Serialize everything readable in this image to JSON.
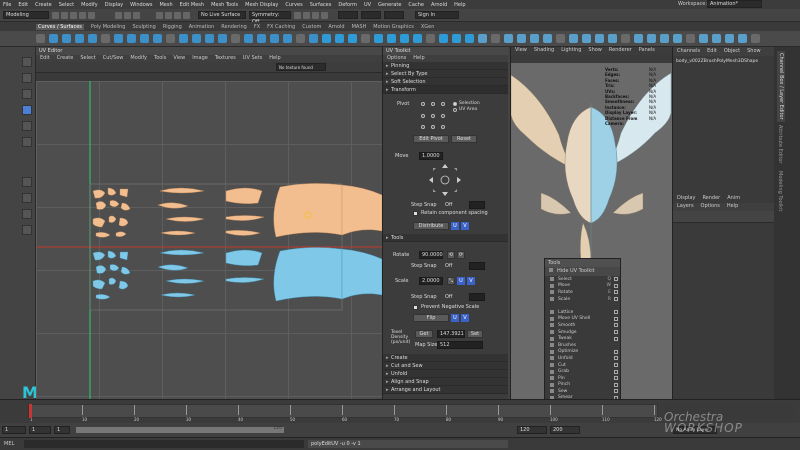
{
  "menubar": {
    "items": [
      "File",
      "Edit",
      "Create",
      "Select",
      "Modify",
      "Display",
      "Windows",
      "Mesh",
      "Edit Mesh",
      "Mesh Tools",
      "Mesh Display",
      "Curves",
      "Surfaces",
      "Deform",
      "UV",
      "Generate",
      "Cache",
      "Arnold",
      "Help"
    ],
    "workspace_label": "Workspace:",
    "workspace_value": "Animation*"
  },
  "statusline": {
    "mode": "Modeling",
    "live_surface": "No Live Surface",
    "symmetry": "Symmetry: Off",
    "sign_in": "Sign In"
  },
  "shelf": {
    "tabs": [
      "Curves / Surfaces",
      "Poly Modeling",
      "Sculpting",
      "Rigging",
      "Animation",
      "Rendering",
      "FX",
      "FX Caching",
      "Custom",
      "Arnold",
      "MASH",
      "Motion Graphics",
      "XGen"
    ],
    "active": "Curves / Surfaces"
  },
  "uv_editor": {
    "title": "UV Editor",
    "menu": [
      "Edit",
      "Create",
      "Select",
      "Cut/Sew",
      "Modify",
      "Tools",
      "View",
      "Image",
      "Textures",
      "UV Sets",
      "Help"
    ],
    "texture_field": "No texture found",
    "status": "(19/38) UV shells, (0/0) overlapping UVs, (0/0) reversed UVs"
  },
  "uv_toolkit": {
    "title": "UV Toolkit",
    "menu": [
      "Options",
      "Help"
    ],
    "sections_top": [
      "Pinning",
      "Select By Type",
      "Soft Selection"
    ],
    "transform": {
      "header": "Transform",
      "pivot_label": "Pivot",
      "pivot_opt1": "Selection",
      "pivot_opt2": "UV Area",
      "edit_pivot": "Edit Pivot",
      "reset": "Reset",
      "move_label": "Move",
      "move_value": "1.0000",
      "step_snap_label": "Step Snap",
      "step_snap_value": "Off",
      "retain_spacing": "Retain component spacing",
      "distribute": "Distribute",
      "u": "U",
      "v": "V"
    },
    "tools": {
      "header": "Tools",
      "rotate_label": "Rotate",
      "rotate_value": "90.0000",
      "scale_label": "Scale",
      "scale_value": "2.0000",
      "prevent_negative": "Prevent Negative Scale",
      "flip": "Flip",
      "texel_label": "Texel Density (px/unit)",
      "get": "Get",
      "density_value": "147.3921",
      "set": "Set",
      "map_size_label": "Map Size:",
      "map_size_value": "512"
    },
    "sections_bottom": [
      "Create",
      "Cut and Sew",
      "Unfold",
      "Align and Snap",
      "Arrange and Layout",
      "UV Sets"
    ]
  },
  "viewport": {
    "menu": [
      "View",
      "Shading",
      "Lighting",
      "Show",
      "Renderer",
      "Panels"
    ],
    "hud": [
      {
        "label": "Verts:",
        "value": "N/A"
      },
      {
        "label": "Edges:",
        "value": "N/A"
      },
      {
        "label": "Faces:",
        "value": "N/A"
      },
      {
        "label": "Tris:",
        "value": "N/A"
      },
      {
        "label": "UVs:",
        "value": "N/A"
      },
      {
        "label": "Backfaces:",
        "value": "N/A"
      },
      {
        "label": "Smoothness:",
        "value": "N/A"
      },
      {
        "label": "Instance:",
        "value": "N/A"
      },
      {
        "label": "Display Layer:",
        "value": "N/A"
      },
      {
        "label": "Distance From Camera:",
        "value": "N/A"
      }
    ]
  },
  "channel_box": {
    "menu": [
      "Channels",
      "Edit",
      "Object",
      "Show"
    ],
    "object_name": "body_v002ZBrushPolyMesh3DShape",
    "display_tabs": [
      "Display",
      "Render",
      "Anim"
    ],
    "display_menu": [
      "Layers",
      "Options",
      "Help"
    ],
    "side_tabs": [
      "Channel Box / Layer Editor",
      "Attribute Editor",
      "Modeling Toolkit"
    ]
  },
  "tools_panel": {
    "title": "Tools",
    "hide": "Hide UV Toolkit",
    "items": [
      {
        "label": "Select",
        "key": "Q"
      },
      {
        "label": "Move",
        "key": "W"
      },
      {
        "label": "Rotate",
        "key": "E"
      },
      {
        "label": "Scale",
        "key": "R"
      },
      {
        "label": "",
        "key": ""
      },
      {
        "label": "Lattice",
        "key": ""
      },
      {
        "label": "Move UV Shell",
        "key": ""
      },
      {
        "label": "Smooth",
        "key": ""
      },
      {
        "label": "Smudge",
        "key": ""
      },
      {
        "label": "Tweak",
        "key": ""
      },
      {
        "label": "Brushes",
        "key": ""
      },
      {
        "label": "Optimize",
        "key": ""
      },
      {
        "label": "Unfold",
        "key": ""
      },
      {
        "label": "Cut",
        "key": ""
      },
      {
        "label": "Grab",
        "key": ""
      },
      {
        "label": "Pin",
        "key": ""
      },
      {
        "label": "Pinch",
        "key": ""
      },
      {
        "label": "Sew",
        "key": ""
      },
      {
        "label": "Smear",
        "key": ""
      },
      {
        "label": "Symmetrize",
        "key": ""
      }
    ]
  },
  "timeline": {
    "ticks": [
      "1",
      "10",
      "20",
      "30",
      "40",
      "50",
      "60",
      "70",
      "80",
      "90",
      "100",
      "110",
      "120"
    ],
    "start": "1",
    "start2": "1",
    "current": "1",
    "end": "120",
    "end2": "120",
    "max": "200",
    "anim_layer": "No Anim Layer"
  },
  "command_line": {
    "lang": "MEL",
    "output": "polyEditUV -u 0 -v 1"
  },
  "watermark": {
    "line1": "Orchestra",
    "line2": "WORKSHOP"
  },
  "colors": {
    "orange_uv": "#f3be8f",
    "blue_uv": "#7fc8e8",
    "accent_blue": "#3b62c9",
    "maya_logo": "#2ec4d6"
  }
}
